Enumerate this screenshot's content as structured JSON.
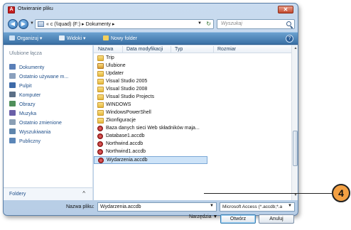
{
  "window": {
    "title": "Otwieranie pliku",
    "app_icon_letter": "A",
    "close_glyph": "✕"
  },
  "address": {
    "back_glyph": "◀",
    "forward_glyph": "▶",
    "path": "« c (\\\\quad) (F:) ▸ Dokumenty ▸",
    "search_placeholder": "Wyszukaj"
  },
  "toolbar": {
    "organize_label": "Organizuj",
    "views_label": "Widoki",
    "new_folder_label": "Nowy folder"
  },
  "sidebar": {
    "favorites_header": "Ulubione łącza",
    "items": [
      {
        "label": "Dokumenty",
        "icon": "documents-icon",
        "color": "#5a7fb8"
      },
      {
        "label": "Ostatnio używane m...",
        "icon": "recent-icon",
        "color": "#8aa0bd"
      },
      {
        "label": "Pulpit",
        "icon": "desktop-icon",
        "color": "#3d6aa8"
      },
      {
        "label": "Komputer",
        "icon": "computer-icon",
        "color": "#5b6f86"
      },
      {
        "label": "Obrazy",
        "icon": "pictures-icon",
        "color": "#4f8f5a"
      },
      {
        "label": "Muzyka",
        "icon": "music-icon",
        "color": "#6a5fa8"
      },
      {
        "label": "Ostatnio zmienione",
        "icon": "recently-changed-icon",
        "color": "#8a9fb5"
      },
      {
        "label": "Wyszukiwania",
        "icon": "searches-icon",
        "color": "#5f86ad"
      },
      {
        "label": "Publiczny",
        "icon": "public-icon",
        "color": "#5b86b8"
      }
    ],
    "folders_label": "Foldery",
    "folders_chevron": "^"
  },
  "columns": [
    "Nazwa",
    "Data modyfikacji",
    "Typ",
    "Rozmiar"
  ],
  "files": [
    {
      "name": "Trip",
      "kind": "folder"
    },
    {
      "name": "Ulubione",
      "kind": "special"
    },
    {
      "name": "Updater",
      "kind": "folder"
    },
    {
      "name": "Visual Studio 2005",
      "kind": "folder"
    },
    {
      "name": "Visual Studio 2008",
      "kind": "folder"
    },
    {
      "name": "Visual Studio Projects",
      "kind": "folder"
    },
    {
      "name": "WINDOWS",
      "kind": "folder"
    },
    {
      "name": "WindowsPowerShell",
      "kind": "folder"
    },
    {
      "name": "Zkonfiguracje",
      "kind": "folder"
    },
    {
      "name": "Baza danych sieci Web składników maja...",
      "kind": "access"
    },
    {
      "name": "Database1.accdb",
      "kind": "access"
    },
    {
      "name": "Northwind.accdb",
      "kind": "access"
    },
    {
      "name": "Northwind1.accdb",
      "kind": "access"
    },
    {
      "name": "Wydarzenia.accdb",
      "kind": "access",
      "selected": true
    }
  ],
  "bottom": {
    "name_label": "Nazwa pliku:",
    "name_value": "Wydarzenia.accdb",
    "filter_value": "Microsoft Access (*.accdb;*.a",
    "tools_label": "Narzędzia",
    "open_label": "Otwórz",
    "cancel_label": "Anuluj"
  },
  "callout": {
    "number": "4"
  }
}
